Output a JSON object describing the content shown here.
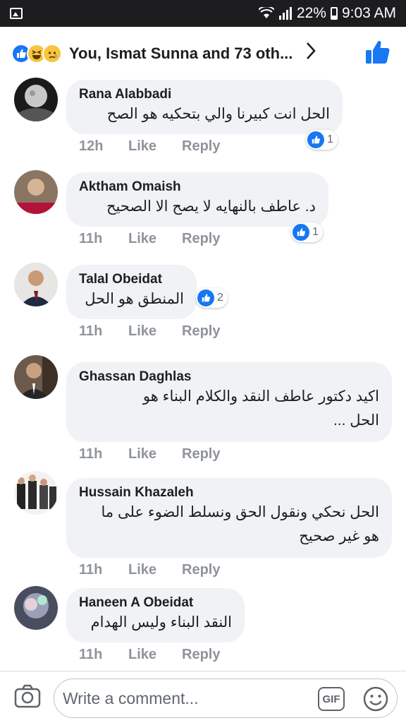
{
  "status_bar": {
    "battery": "22%",
    "time": "9:03 AM"
  },
  "header": {
    "title": "You, Ismat Sunna and 73 oth...",
    "reaction_icons": [
      "like-icon",
      "haha-icon",
      "sad-icon"
    ]
  },
  "comments": [
    {
      "author": "Rana Alabbadi",
      "text_lines": [
        "الحل انت كبيرنا والي بتحكيه هو الصح"
      ],
      "time": "12h",
      "like_label": "Like",
      "reply_label": "Reply",
      "reactions": "1"
    },
    {
      "author": "Aktham Omaish",
      "text_lines": [
        "د. عاطف بالنهايه لا يصح الا الصحيح"
      ],
      "time": "11h",
      "like_label": "Like",
      "reply_label": "Reply",
      "reactions": "1"
    },
    {
      "author": "Talal Obeidat",
      "text_lines": [
        "المنطق هو الحل"
      ],
      "time": "11h",
      "like_label": "Like",
      "reply_label": "Reply",
      "reactions": "2"
    },
    {
      "author": "Ghassan Daghlas",
      "text_lines": [
        "اكيد دكتور عاطف النقد والكلام البناء هو",
        "الحل ..."
      ],
      "time": "11h",
      "like_label": "Like",
      "reply_label": "Reply"
    },
    {
      "author": "Hussain Khazaleh",
      "text_lines": [
        "الحل نحكي ونقول الحق ونسلط الضوء على ما",
        "هو غير صحيح"
      ],
      "time": "11h",
      "like_label": "Like",
      "reply_label": "Reply"
    },
    {
      "author": "Haneen A Obeidat",
      "text_lines": [
        "النقد البناء وليس الهدام"
      ],
      "time": "11h",
      "like_label": "Like",
      "reply_label": "Reply"
    }
  ],
  "composer": {
    "placeholder": "Write a comment...",
    "gif_label": "GIF"
  },
  "colors": {
    "accent": "#1877f2",
    "bubble": "#f0f2f5",
    "meta": "#8f939a"
  }
}
